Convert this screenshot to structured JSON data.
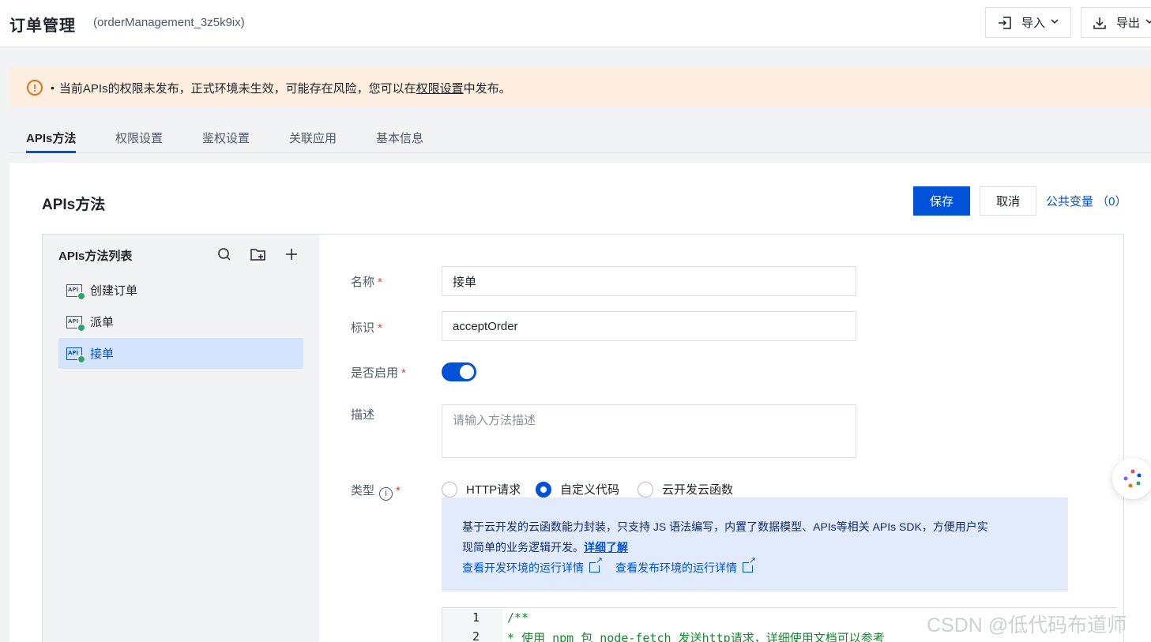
{
  "header": {
    "title": "订单管理",
    "identifier": "(orderManagement_3z5k9ix)",
    "import_label": "导入",
    "export_label": "导出"
  },
  "banner": {
    "text_prefix": "当前APIs的权限未发布，正式环境未生效，可能存在风险，您可以在",
    "link": "权限设置",
    "text_suffix": "中发布。"
  },
  "tabs": [
    "APIs方法",
    "权限设置",
    "鉴权设置",
    "关联应用",
    "基本信息"
  ],
  "main": {
    "title": "APIs方法",
    "save_label": "保存",
    "cancel_label": "取消",
    "vars_label": "公共变量 （0）"
  },
  "sidebar": {
    "title": "APIs方法列表",
    "items": [
      {
        "label": "创建订单",
        "icon": "api-icon"
      },
      {
        "label": "派单",
        "icon": "api-icon"
      },
      {
        "label": "接单",
        "icon": "api-icon",
        "selected": true
      }
    ]
  },
  "form": {
    "name_label": "名称",
    "name_value": "接单",
    "id_label": "标识",
    "id_value": "acceptOrder",
    "enabled_label": "是否启用",
    "enabled": true,
    "desc_label": "描述",
    "desc_placeholder": "请输入方法描述",
    "type_label": "类型",
    "type_options": [
      "HTTP请求",
      "自定义代码",
      "云开发云函数"
    ],
    "type_selected": "自定义代码"
  },
  "infobox": {
    "line1": "基于云开发的云函数能力封装，只支持 JS 语法编写，内置了数据模型、APIs等相关 APIs SDK，方便用户实",
    "line2": "现简单的业务逻辑开发。",
    "more": "详细了解",
    "dev_link": "查看开发环境的运行详情",
    "prod_link": "查看发布环境的运行详情"
  },
  "code": {
    "lines": [
      {
        "no": "1",
        "text": "/**"
      },
      {
        "no": "2",
        "text": "* 使用 npm 包 node-fetch 发送http请求，详细使用文档可以参考"
      }
    ]
  },
  "watermark": "CSDN @低代码布道师",
  "colors": {
    "primary": "#0052d9",
    "warning_bg": "#fdeee0",
    "warning": "#e37318",
    "required": "#d54941"
  }
}
